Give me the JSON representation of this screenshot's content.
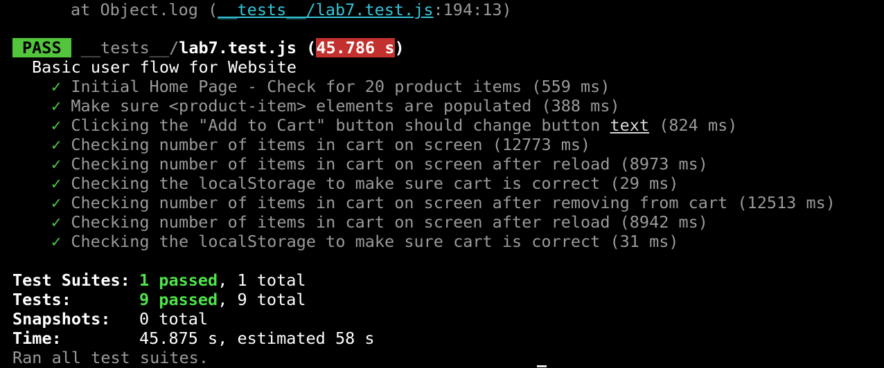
{
  "top_line": {
    "prefix": "at Object.log (",
    "path": "__tests__/lab7.test.js",
    "suffix": ":194:13)"
  },
  "result": {
    "badge": "PASS",
    "dir": "__tests__/",
    "file": "lab7.test.js",
    "open_paren": " (",
    "duration": "45.786 s",
    "close_paren": ")"
  },
  "suite": {
    "name": "Basic user flow for Website"
  },
  "check_glyph": "✓",
  "tests": [
    {
      "name": "Initial Home Page - Check for 20 product items",
      "time": "(559 ms)"
    },
    {
      "name": "Make sure <product-item> elements are populated",
      "time": "(388 ms)"
    },
    {
      "name_pre": "Clicking the \"Add to Cart\" button should change button ",
      "name_ul": "text",
      "time": "(824 ms)"
    },
    {
      "name": "Checking number of items in cart on screen",
      "time": "(12773 ms)"
    },
    {
      "name": "Checking number of items in cart on screen after reload",
      "time": "(8973 ms)"
    },
    {
      "name": "Checking the localStorage to make sure cart is correct",
      "time": "(29 ms)"
    },
    {
      "name": "Checking number of items in cart on screen after removing from cart",
      "time": "(12513 ms)"
    },
    {
      "name": "Checking number of items in cart on screen after reload",
      "time": "(8942 ms)"
    },
    {
      "name": "Checking the localStorage to make sure cart is correct",
      "time": "(31 ms)"
    }
  ],
  "summary": {
    "suites_label": "Test Suites:",
    "suites_passed": "1 passed",
    "suites_total": ", 1 total",
    "tests_label": "Tests:",
    "tests_passed": "9 passed",
    "tests_total": ", 9 total",
    "snapshots_label": "Snapshots:",
    "snapshots_value": "0 total",
    "time_label": "Time:",
    "time_value": "45.875 s, estimated 58 s",
    "ran_all": "Ran all test suites."
  },
  "colors": {
    "pass_badge": "#53c53c",
    "time_badge": "#c2312d",
    "passed_text": "#4fe44a",
    "path_link": "#35c6d8"
  }
}
